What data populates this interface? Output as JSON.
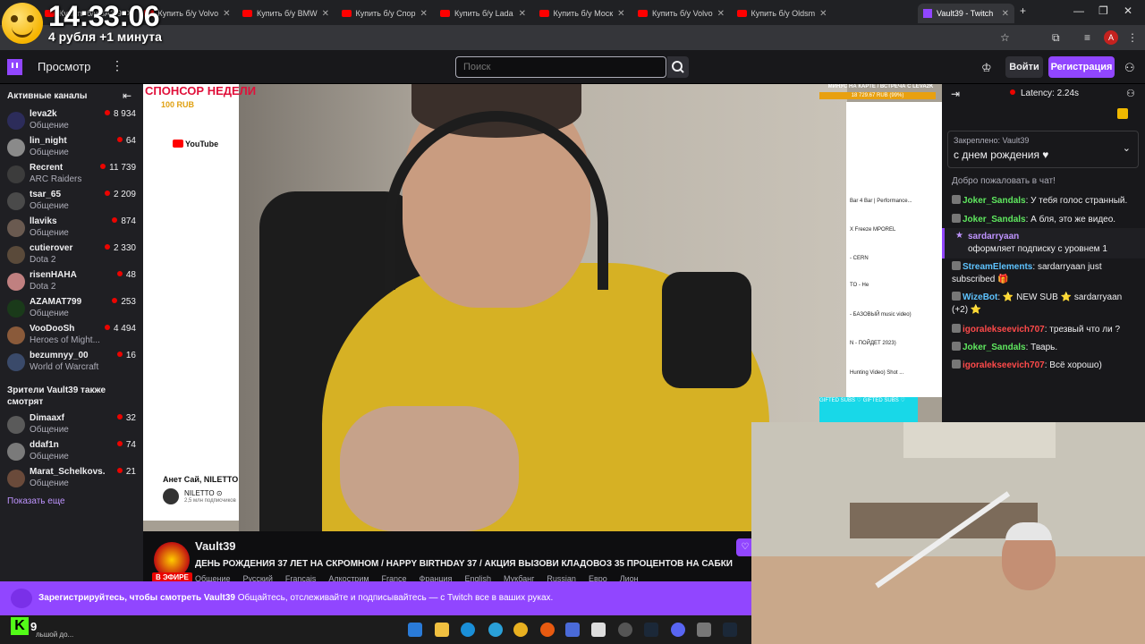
{
  "browser": {
    "tabs": [
      {
        "label": "Купить б/у ЗАЗ 9",
        "type": "yt"
      },
      {
        "label": "Купить б/у Volvo",
        "type": "yt"
      },
      {
        "label": "Купить б/у BMW",
        "type": "yt"
      },
      {
        "label": "Купить б/у Спор",
        "type": "yt"
      },
      {
        "label": "Купить б/у Lada",
        "type": "yt"
      },
      {
        "label": "Купить б/у Моск",
        "type": "yt"
      },
      {
        "label": "Купить б/у Volvo",
        "type": "yt"
      },
      {
        "label": "Купить б/у Oldsm",
        "type": "yt"
      },
      {
        "label": "Vault39 - Twitch",
        "type": "twitch"
      }
    ],
    "new_tab": "+"
  },
  "overlay": {
    "clock": "14:33:06",
    "clock_sub": "4 рубля +1 минута"
  },
  "nav": {
    "browse": "Просмотр",
    "search_placeholder": "Поиск",
    "login": "Войти",
    "signup": "Регистрация"
  },
  "sidebar": {
    "title": "Активные каналы",
    "channels": [
      {
        "name": "leva2k",
        "category": "Общение",
        "viewers": "8 934",
        "color": "#2c2c5a"
      },
      {
        "name": "lin_night",
        "category": "Общение",
        "viewers": "64",
        "color": "#8a8a8a"
      },
      {
        "name": "Recrent",
        "category": "ARC Raiders",
        "viewers": "11 739",
        "color": "#3c3c3c"
      },
      {
        "name": "tsar_65",
        "category": "Общение",
        "viewers": "2 209",
        "color": "#4a4a4a"
      },
      {
        "name": "llaviks",
        "category": "Общение",
        "viewers": "874",
        "color": "#6a5a50"
      },
      {
        "name": "cutierover",
        "category": "Dota 2",
        "viewers": "2 330",
        "color": "#5a4a3a"
      },
      {
        "name": "risenHAHA",
        "category": "Dota 2",
        "viewers": "48",
        "color": "#c08080"
      },
      {
        "name": "AZAMAT799",
        "category": "Общение",
        "viewers": "253",
        "color": "#1a3a1a"
      },
      {
        "name": "VooDooSh",
        "category": "Heroes of Might...",
        "viewers": "4 494",
        "color": "#8a5a3a"
      },
      {
        "name": "bezumnyy_00",
        "category": "World of Warcraft",
        "viewers": "16",
        "color": "#3a4a6a"
      }
    ],
    "also_title": "Зрители Vault39 также смотрят",
    "also_channels": [
      {
        "name": "Dimaaxf",
        "category": "Общение",
        "viewers": "32",
        "color": "#5a5a5a"
      },
      {
        "name": "ddaf1n",
        "category": "Общение",
        "viewers": "74",
        "color": "#7a7a7a"
      },
      {
        "name": "Marat_Schelkovs...",
        "category": "Общение",
        "viewers": "21",
        "color": "#6a4a3a"
      }
    ],
    "show_more": "Показать еще"
  },
  "video": {
    "sponsor": "СПОНСОР НЕДЕЛИ",
    "sponsor_sub": "100 RUB",
    "goal_text": "МИНУС НА КАРТЕ / ВСТРЕЧА С LEVA2K",
    "goal_bar": "18 729.67 RUB (99%)",
    "goal_progress": 0.99,
    "yt_logo": "YouTube",
    "yt_caption": "Анет Сай, NILETTO",
    "yt_channel": "NILETTO ⊙",
    "yt_subs": "2,5 млн подписчиков",
    "gifted": "GIFTED SUBS ♡ GIFTED SUBS ♡",
    "side_items": [
      "Bar 4 Bar | Performance...",
      "X Freeze MPOREL",
      "- CERN",
      "TO - He",
      "- БАЗОВЫЙ music video)",
      "N - ПОЙДЕТ 2023)",
      "Hunting Video) Shot ..."
    ]
  },
  "stream": {
    "streamer": "Vault39",
    "title": "ДЕНЬ РОЖДЕНИЯ 37 ЛЕТ НА СКРОМНОМ / HAPPY BIRTHDAY 37 / АКЦИЯ ВЫЗОВИ КЛАДОВОЗ 35 ПРОЦЕНТОВ НА САБКИ",
    "live": "В ЭФИРЕ",
    "tags": [
      "Общение",
      "Русский",
      "Francais",
      "Алкострим",
      "France",
      "Франция",
      "English",
      "Мукбанг",
      "Russian",
      "Евро",
      "Лион"
    ]
  },
  "chat": {
    "latency": "Latency: 2.24s",
    "pinned_label": "Закреплено: Vault39",
    "pinned_msg": "с днем рождения ♥",
    "welcome": "Добро пожаловать в чат!",
    "messages": [
      {
        "user": "Joker_Sandals",
        "color": "#5fe85f",
        "text": "У тебя голос странный."
      },
      {
        "user": "Joker_Sandals",
        "color": "#5fe85f",
        "text": "А бля, это же видео."
      },
      {
        "user": "StreamElements",
        "color": "#5ec3ff",
        "text": "sardarryaan just subscribed 🎁"
      },
      {
        "user": "WizeBot",
        "color": "#5ec3ff",
        "text": "⭐ NEW SUB ⭐ sardarryaan (+2) ⭐"
      },
      {
        "user": "igoralekseevich707",
        "color": "#ff4a4a",
        "text": "трезвый что ли ?"
      },
      {
        "user": "Joker_Sandals",
        "color": "#5fe85f",
        "text": "Тварь."
      },
      {
        "user": "igoralekseevich707",
        "color": "#ff4a4a",
        "text": "Всё хорошо)"
      }
    ],
    "sub_user": "sardarryaan",
    "sub_text": "оформляет подписку с уровнем 1"
  },
  "banner": {
    "bold": "Зарегистрируйтесь, чтобы смотреть Vault39",
    "text": "Общайтесь, отслеживайте и подписывайтесь — с Twitch все в ваших руках."
  },
  "taskbar": {
    "kick_count": "9",
    "caption": "льшой до..."
  }
}
